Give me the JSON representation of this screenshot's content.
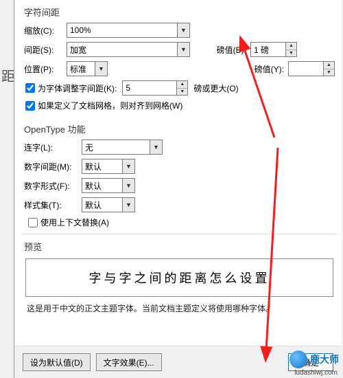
{
  "leftHint": "距",
  "topSection": "字符间距",
  "scale": {
    "label": "缩放(C):",
    "value": "100%"
  },
  "spacing": {
    "label": "间距(S):",
    "value": "加宽"
  },
  "byValue": {
    "label": "磅值(B):",
    "value": "1 磅"
  },
  "position": {
    "label": "位置(P):",
    "value": "标准"
  },
  "byValueY": {
    "label": "磅值(Y):",
    "value": ""
  },
  "kern": {
    "label": "为字体调整字间距(K):",
    "value": "5",
    "suffixLabel": "磅或更大(O)"
  },
  "snap": {
    "label": "如果定义了文档网格，则对齐到网格(W)"
  },
  "opentype": {
    "title": "OpenType 功能",
    "ligature": {
      "label": "连字(L):",
      "value": "无"
    },
    "numSpacing": {
      "label": "数字间距(M):",
      "value": "默认"
    },
    "numForm": {
      "label": "数字形式(F):",
      "value": "默认"
    },
    "styleSet": {
      "label": "样式集(T):",
      "value": "默认"
    },
    "context": {
      "label": "使用上下文替换(A)"
    }
  },
  "preview": {
    "title": "预览",
    "text": "字与字之间的距离怎么设置",
    "note": "这是用于中文的正文主题字体。当前文档主题定义将使用哪种字体。"
  },
  "buttons": {
    "default": "设为默认值(D)",
    "effects": "文字效果(E)...",
    "ok": "确定"
  },
  "watermark": {
    "brand": "鹿大师",
    "url": "ludashiwj.com"
  }
}
